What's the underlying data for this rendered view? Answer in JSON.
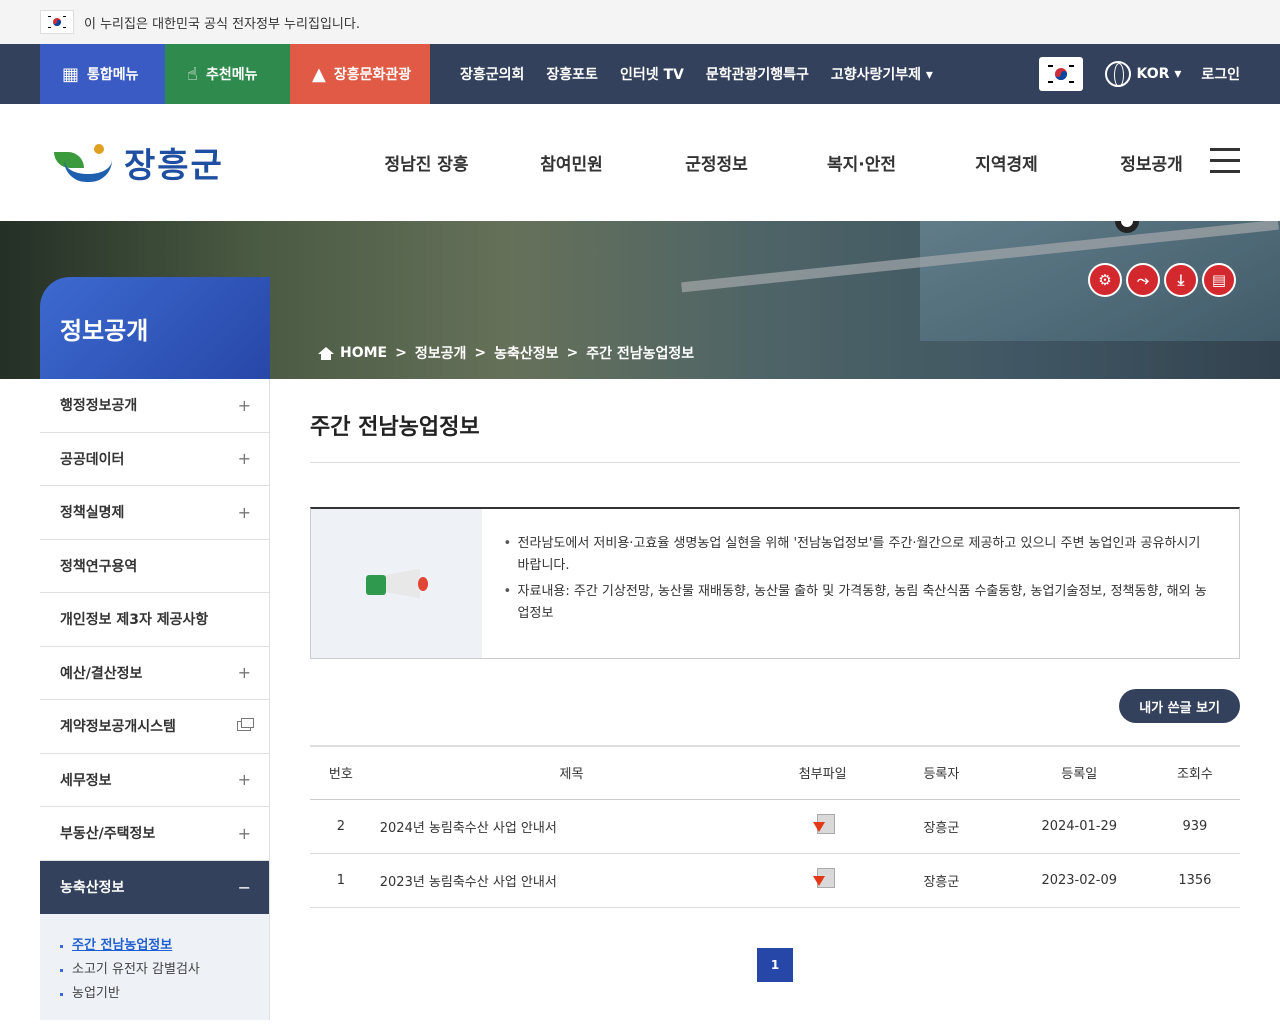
{
  "gov_bar": {
    "text": "이 누리집은 대한민국 공식 전자정부 누리집입니다."
  },
  "util": {
    "buttons": [
      "통합메뉴",
      "추천메뉴",
      "장흥문화관광"
    ],
    "links": [
      "장흥군의회",
      "장흥포토",
      "인터넷 TV",
      "문학관광기행특구",
      "고향사랑기부제 ▾"
    ],
    "lang": "KOR ▾",
    "login": "로그인"
  },
  "header": {
    "logo_text": "장흥군",
    "gnb": [
      "정남진 장흥",
      "참여민원",
      "군정정보",
      "복지·안전",
      "지역경제",
      "정보공개"
    ]
  },
  "visual": {
    "section_title": "정보공개",
    "breadcrumb": [
      "HOME",
      "정보공개",
      "농축산정보",
      "주간 전남농업정보"
    ]
  },
  "lnb": {
    "items": [
      {
        "label": "행정정보공개",
        "icon": "plus"
      },
      {
        "label": "공공데이터",
        "icon": "plus"
      },
      {
        "label": "정책실명제",
        "icon": "plus"
      },
      {
        "label": "정책연구용역",
        "icon": ""
      },
      {
        "label": "개인정보 제3자 제공사항",
        "icon": ""
      },
      {
        "label": "예산/결산정보",
        "icon": "plus"
      },
      {
        "label": "계약정보공개시스템",
        "icon": "window"
      },
      {
        "label": "세무정보",
        "icon": "plus"
      },
      {
        "label": "부동산/주택정보",
        "icon": "plus"
      },
      {
        "label": "농축산정보",
        "icon": "minus"
      }
    ],
    "sub": [
      "주간 전남농업정보",
      "소고기 유전자 감별검사",
      "농업기반"
    ]
  },
  "main": {
    "title": "주간 전남농업정보",
    "notice": [
      "전라남도에서 저비용·고효율 생명농업 실현을 위해 '전남농업정보'를 주간·월간으로 제공하고 있으니 주변 농업인과 공유하시기 바랍니다.",
      "자료내용: 주간 기상전망, 농산물 재배동향, 농산물 출하 및 가격동향, 농림 축산식품 수출동향, 농업기술정보, 정책동향, 해외 농업정보"
    ],
    "my_posts": "내가 쓴글 보기",
    "table": {
      "headers": [
        "번호",
        "제목",
        "첨부파일",
        "등록자",
        "등록일",
        "조회수"
      ],
      "rows": [
        {
          "no": "2",
          "title": "2024년 농림축수산 사업 안내서",
          "author": "장흥군",
          "date": "2024-01-29",
          "views": "939"
        },
        {
          "no": "1",
          "title": "2023년 농림축수산 사업 안내서",
          "author": "장흥군",
          "date": "2023-02-09",
          "views": "1356"
        }
      ]
    },
    "page": "1"
  }
}
